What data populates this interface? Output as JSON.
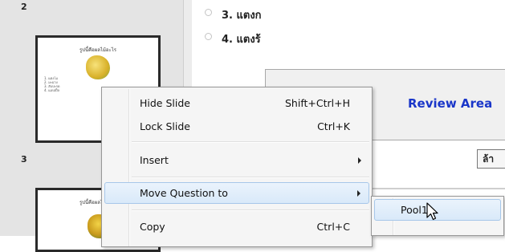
{
  "thumbnails": {
    "top_number": "2",
    "slide2": {
      "title": "รูปนี้คือผลไม้อะไร",
      "options": [
        "1. แตงโม",
        "2. มะม่วง",
        "3. สับปะรด",
        "4. แอปเปิ้ล"
      ]
    },
    "slide3_number": "3",
    "slide3": {
      "title": "รูปนี้คือผลไม้อะไร"
    }
  },
  "content": {
    "option3": "3. แตงก",
    "option4": "4. แตงร้",
    "review_label": "Review Area",
    "partial_button": "ล้า"
  },
  "context_menu": {
    "items": [
      {
        "label": "Hide Slide",
        "shortcut": "Shift+Ctrl+H"
      },
      {
        "label": "Lock Slide",
        "shortcut": "Ctrl+K"
      },
      {
        "label": "Insert"
      },
      {
        "label": "Move Question to"
      },
      {
        "label": "Copy",
        "shortcut": "Ctrl+C"
      }
    ]
  },
  "submenu": {
    "items": [
      "Pool1"
    ]
  },
  "colors": {
    "review_label": "#1a36c9",
    "highlight_border": "#a7c7e9"
  }
}
